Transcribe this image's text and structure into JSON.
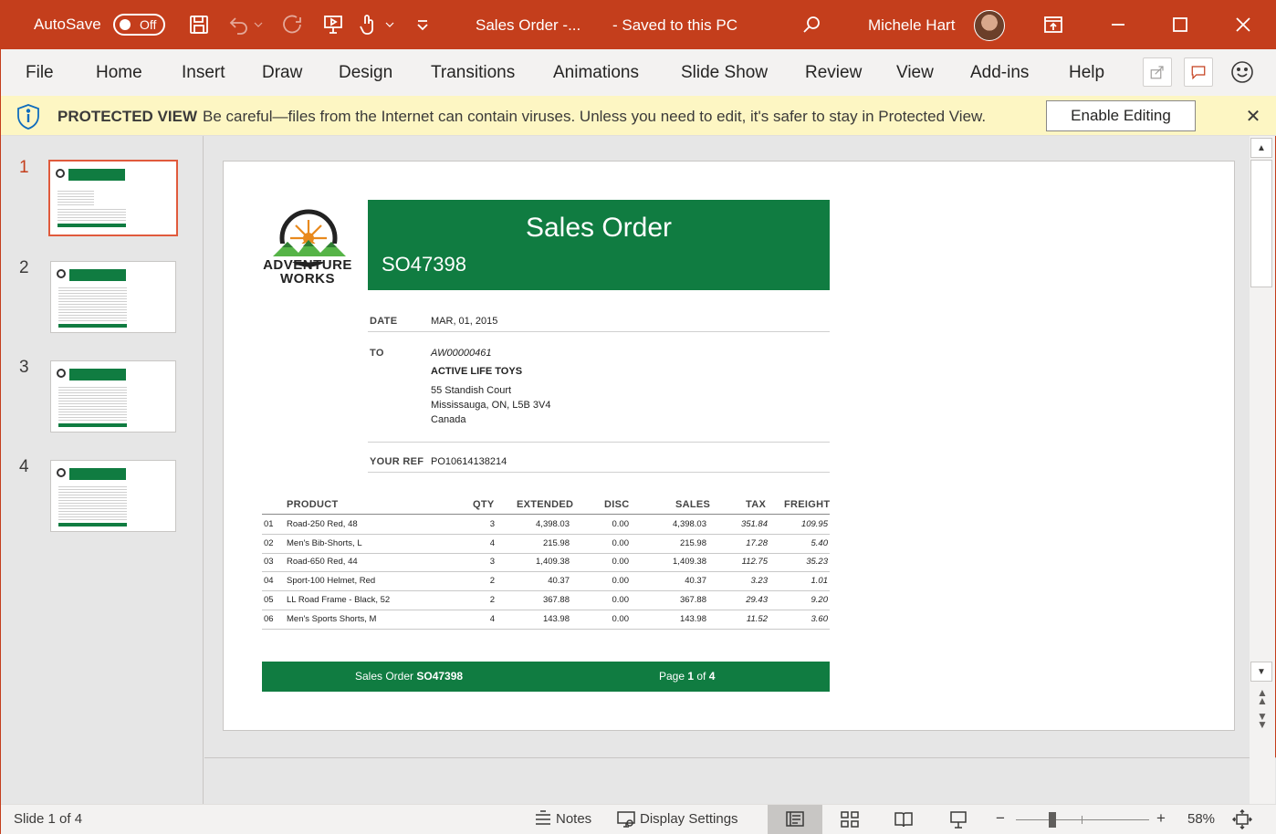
{
  "titlebar": {
    "autosave_label": "AutoSave",
    "autosave_state": "Off",
    "doc_title": "Sales Order  -...",
    "save_status": "-  Saved to this PC",
    "user_name": "Michele Hart"
  },
  "menu": {
    "items": [
      "File",
      "Home",
      "Insert",
      "Draw",
      "Design",
      "Transitions",
      "Animations",
      "Slide Show",
      "Review",
      "View",
      "Add-ins",
      "Help"
    ]
  },
  "protected_view": {
    "title": "PROTECTED VIEW",
    "message": "Be careful—files from the Internet can contain viruses. Unless you need to edit, it's safer to stay in Protected View.",
    "enable_button": "Enable Editing",
    "close": "✕"
  },
  "thumbnails": {
    "numbers": [
      "1",
      "2",
      "3",
      "4"
    ],
    "active_index": 0
  },
  "slide": {
    "logo_line1": "ADVENTURE",
    "logo_line2": "WORKS",
    "title": "Sales Order",
    "order_number": "SO47398",
    "date_label": "DATE",
    "date_value": "MAR, 01, 2015",
    "to_label": "TO",
    "customer_id": "AW00000461",
    "customer_name": "ACTIVE LIFE TOYS",
    "address_line1": "55 Standish Court",
    "address_line2": "Mississauga, ON, L5B 3V4",
    "address_line3": "Canada",
    "ref_label": "YOUR REF",
    "ref_value": "PO10614138214",
    "table": {
      "headers": [
        "PRODUCT",
        "QTY",
        "EXTENDED",
        "DISC",
        "SALES",
        "TAX",
        "FREIGHT"
      ],
      "rows": [
        {
          "n": "01",
          "product": "Road-250 Red, 48",
          "qty": "3",
          "extended": "4,398.03",
          "disc": "0.00",
          "sales": "4,398.03",
          "tax": "351.84",
          "freight": "109.95"
        },
        {
          "n": "02",
          "product": "Men's Bib-Shorts, L",
          "qty": "4",
          "extended": "215.98",
          "disc": "0.00",
          "sales": "215.98",
          "tax": "17.28",
          "freight": "5.40"
        },
        {
          "n": "03",
          "product": "Road-650 Red, 44",
          "qty": "3",
          "extended": "1,409.38",
          "disc": "0.00",
          "sales": "1,409.38",
          "tax": "112.75",
          "freight": "35.23"
        },
        {
          "n": "04",
          "product": "Sport-100 Helmet, Red",
          "qty": "2",
          "extended": "40.37",
          "disc": "0.00",
          "sales": "40.37",
          "tax": "3.23",
          "freight": "1.01"
        },
        {
          "n": "05",
          "product": "LL Road Frame - Black, 52",
          "qty": "2",
          "extended": "367.88",
          "disc": "0.00",
          "sales": "367.88",
          "tax": "29.43",
          "freight": "9.20"
        },
        {
          "n": "06",
          "product": "Men's Sports Shorts, M",
          "qty": "4",
          "extended": "143.98",
          "disc": "0.00",
          "sales": "143.98",
          "tax": "11.52",
          "freight": "3.60"
        }
      ]
    },
    "footer_left_prefix": "Sales Order ",
    "footer_left_bold": "SO47398",
    "footer_right_prefix": "Page ",
    "footer_page": "1",
    "footer_of": " of ",
    "footer_total": "4"
  },
  "statusbar": {
    "slide_info": "Slide 1 of 4",
    "notes": "Notes",
    "display_settings": "Display Settings",
    "zoom_minus": "−",
    "zoom_plus": "+",
    "zoom_level": "58%",
    "zoom_fraction": 0.58
  },
  "colors": {
    "accent": "#c43e1c",
    "brand_green": "#107c41",
    "protected_bg": "#fdf6c3"
  }
}
